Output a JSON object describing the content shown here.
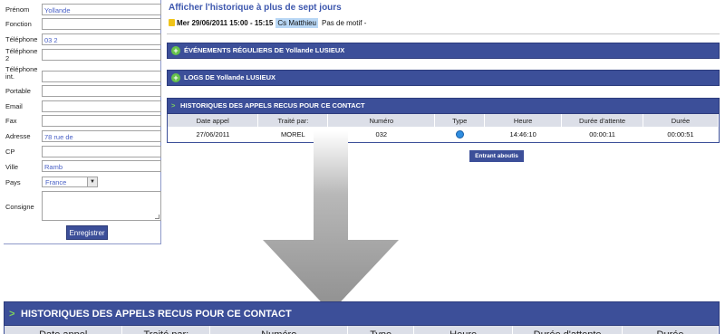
{
  "form": {
    "fields": [
      {
        "label": "Prénom",
        "value": "Yollande"
      },
      {
        "label": "Fonction",
        "value": ""
      },
      {
        "label": "Téléphone",
        "value": "03 2"
      },
      {
        "label": "Téléphone 2",
        "value": ""
      },
      {
        "label": "Téléphone int.",
        "value": ""
      },
      {
        "label": "Portable",
        "value": ""
      },
      {
        "label": "Email",
        "value": ""
      },
      {
        "label": "Fax",
        "value": ""
      },
      {
        "label": "Adresse",
        "value": "78 rue de"
      },
      {
        "label": "CP",
        "value": ""
      },
      {
        "label": "Ville",
        "value": "Ramb"
      }
    ],
    "pays_label": "Pays",
    "pays_value": "France",
    "consigne_label": "Consigne",
    "save_label": "Enregistrer"
  },
  "history": {
    "link": "Afficher l'historique à plus de sept jours",
    "date": "Mer 29/06/2011 15:00 - 15:15",
    "person": "Cs Matthieu",
    "motif": "Pas de motif -"
  },
  "sections": {
    "events": "ÉVÉNEMENTS RÉGULIERS DE Yollande LUSIEUX",
    "logs": "LOGS DE Yollande LUSIEUX",
    "calls": "HISTORIQUES DES APPELS RECUS POUR CE CONTACT"
  },
  "calls_table": {
    "headers": [
      "Date appel",
      "Traité par:",
      "Numéro",
      "Type",
      "Heure",
      "Durée d'attente",
      "Durée"
    ],
    "rows": [
      {
        "date": "27/06/2011",
        "by": "MOREL",
        "number": "032",
        "type_icon": "incoming-call-icon",
        "time": "14:46:10",
        "wait": "00:00:11",
        "duration": "00:00:51"
      }
    ],
    "filter_label": "Entrant aboutis"
  },
  "zoom": {
    "title": "HISTORIQUES DES APPELS RECUS POUR CE CONTACT",
    "headers": [
      "Date appel",
      "Traité par:",
      "Numéro",
      "Type",
      "Heure",
      "Durée d'attente",
      "Durée"
    ]
  },
  "colors": {
    "bar": "#3c4f99",
    "accent": "#66c24a",
    "header_row": "#dcdfe8",
    "arrow": "#9a9a9a"
  }
}
